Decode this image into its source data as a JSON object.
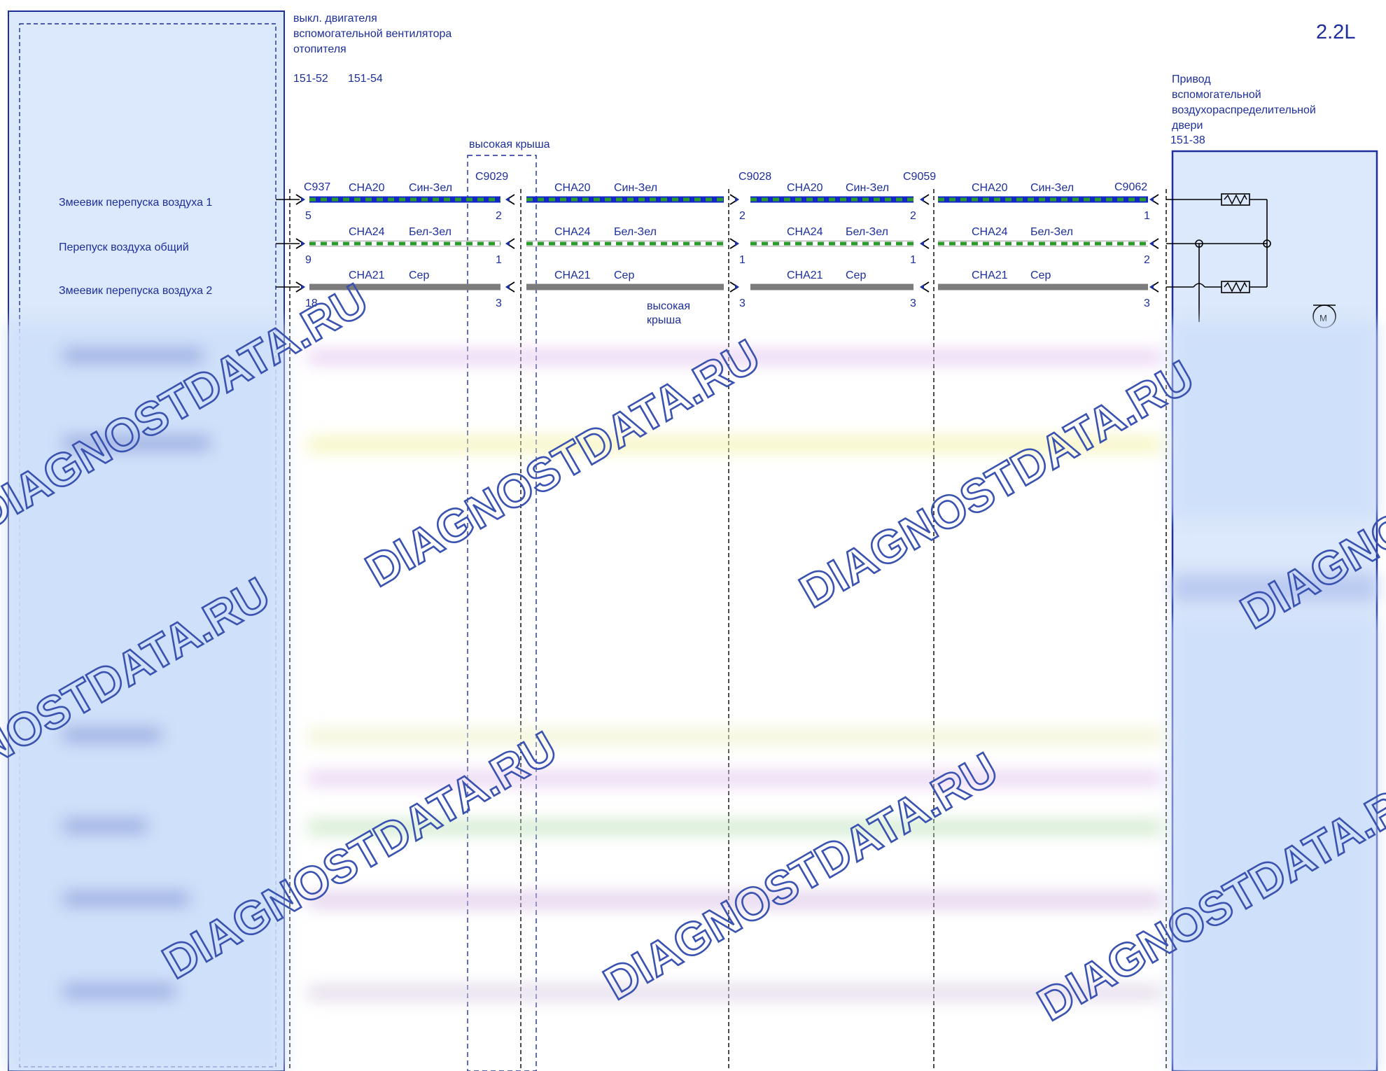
{
  "version_label": "2.2L",
  "left_module": {
    "pins": [
      "Змеевик перепуска воздуха 1",
      "Перепуск воздуха общий",
      "Змеевик перепуска воздуха 2"
    ]
  },
  "top_note": {
    "lines": [
      "выкл. двигателя",
      "вспомогательной вентилятора",
      "отопителя"
    ],
    "refs": [
      "151-52",
      "151-54"
    ]
  },
  "high_roof_label": "высокая крыша",
  "high_roof_label_2_lines": [
    "высокая",
    "крыша"
  ],
  "connectors": {
    "c937": "C937",
    "c9029": "C9029",
    "c9028": "C9028",
    "c9059": "C9059",
    "c9062": "C9062"
  },
  "right_component": {
    "lines": [
      "Привод",
      "вспомогательной",
      "воздухораспределительной",
      "двери"
    ],
    "ref": "151-38",
    "motor_symbol": "M"
  },
  "wires": [
    {
      "code": "CHA20",
      "color_name": "Син-Зел",
      "stroke": "#1428c8",
      "dash": "#2a9a2a",
      "pins": [
        "5",
        "2",
        "2",
        "2",
        "1"
      ]
    },
    {
      "code": "CHA24",
      "color_name": "Бел-Зел",
      "stroke": "#ffffff",
      "dash": "#2a9a2a",
      "pins": [
        "9",
        "1",
        "1",
        "1",
        "2"
      ]
    },
    {
      "code": "CHA21",
      "color_name": "Сер",
      "stroke": "#7c7c7c",
      "dash": "",
      "pins": [
        "18",
        "3",
        "3",
        "3",
        "3"
      ]
    }
  ],
  "watermark": "DIAGNOSTDATA.RU"
}
